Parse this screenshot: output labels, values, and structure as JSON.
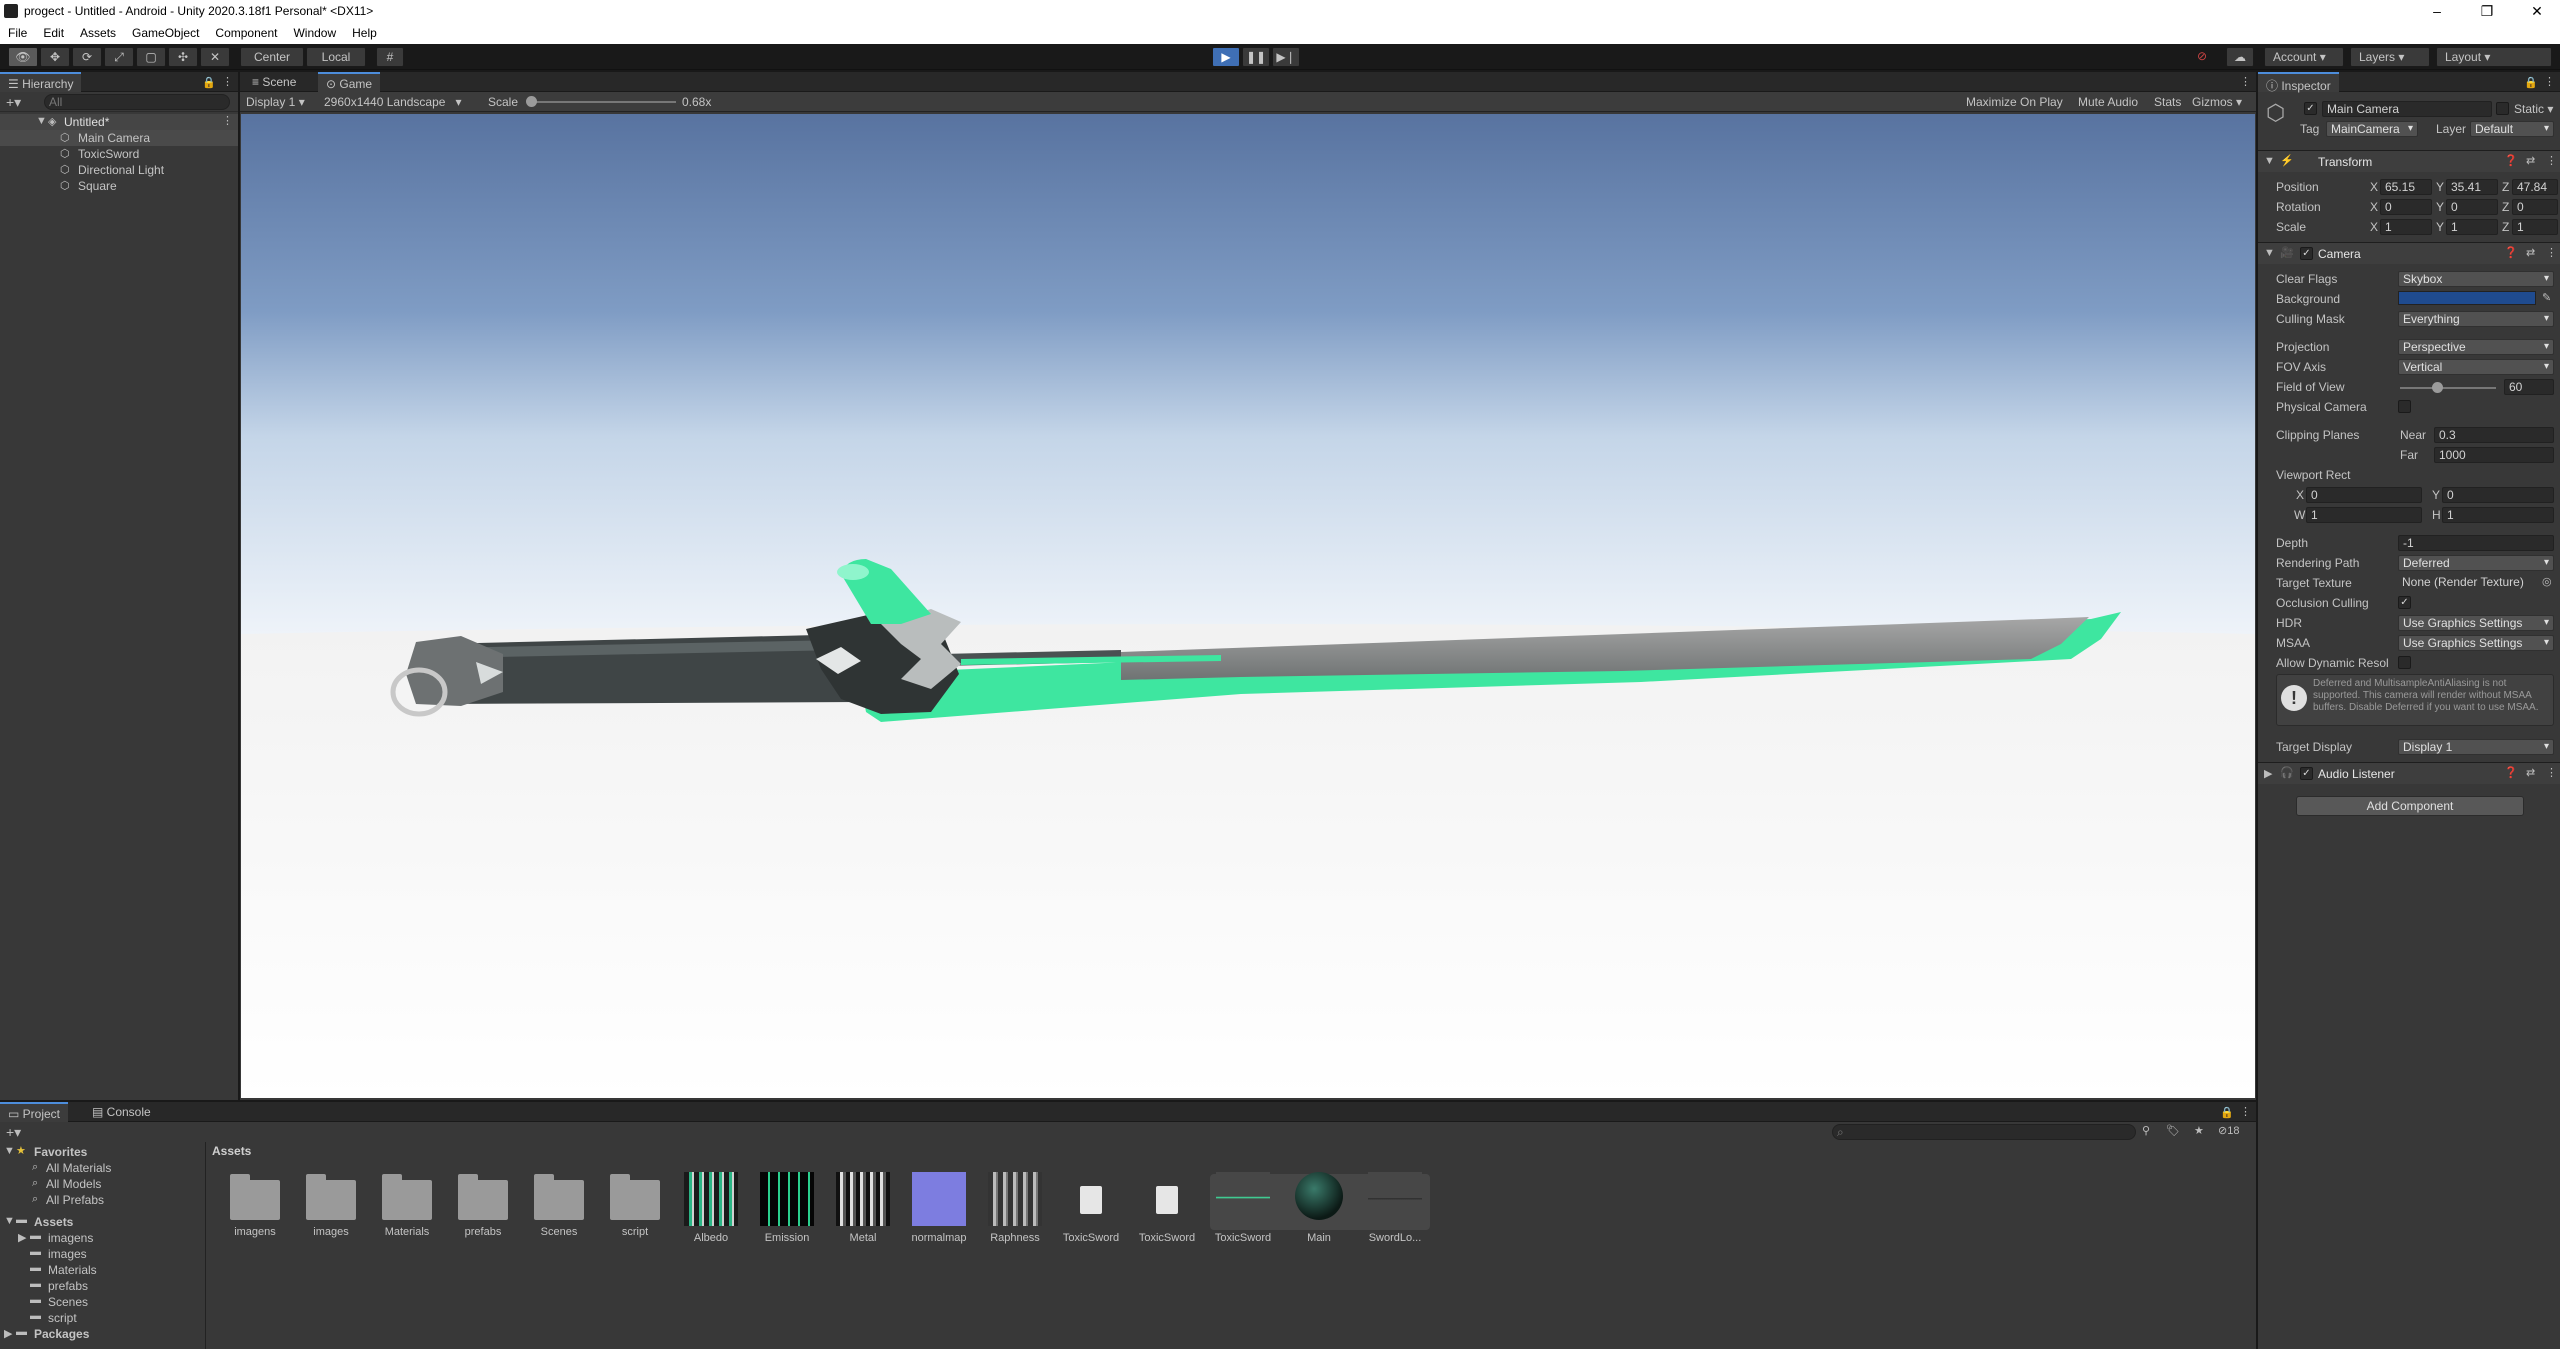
{
  "window": {
    "title": "progect - Untitled - Android - Unity 2020.3.18f1 Personal* <DX11>"
  },
  "menu": [
    "File",
    "Edit",
    "Assets",
    "GameObject",
    "Component",
    "Window",
    "Help"
  ],
  "toolbar": {
    "pivot": "Center",
    "space": "Local",
    "account": "Account",
    "layers": "Layers",
    "layout": "Layout"
  },
  "hierarchy": {
    "tab": "Hierarchy",
    "search_placeholder": "All",
    "scene": "Untitled*",
    "items": [
      "Main Camera",
      "ToxicSword",
      "Directional Light",
      "Square"
    ]
  },
  "game": {
    "tabs": [
      "Scene",
      "Game"
    ],
    "display": "Display 1",
    "resolution": "2960x1440 Landscape",
    "scale_label": "Scale",
    "scale_value": "0.68x",
    "options": [
      "Maximize On Play",
      "Mute Audio",
      "Stats",
      "Gizmos"
    ],
    "sky_top": "#5873a0",
    "sky_horizon": "#dde8f3",
    "ground": "#ffffff",
    "blade_glow": "#3ee6a0"
  },
  "inspector": {
    "tab": "Inspector",
    "object_name": "Main Camera",
    "static_label": "Static",
    "tag_label": "Tag",
    "tag_value": "MainCamera",
    "layer_label": "Layer",
    "layer_value": "Default",
    "transform": {
      "title": "Transform",
      "position": {
        "label": "Position",
        "x": "65.15",
        "y": "35.41",
        "z": "47.84"
      },
      "rotation": {
        "label": "Rotation",
        "x": "0",
        "y": "0",
        "z": "0"
      },
      "scale": {
        "label": "Scale",
        "x": "1",
        "y": "1",
        "z": "1"
      }
    },
    "camera": {
      "title": "Camera",
      "clear_flags": {
        "label": "Clear Flags",
        "value": "Skybox"
      },
      "background": {
        "label": "Background",
        "color": "#1f4b8f"
      },
      "culling_mask": {
        "label": "Culling Mask",
        "value": "Everything"
      },
      "projection": {
        "label": "Projection",
        "value": "Perspective"
      },
      "fov_axis": {
        "label": "FOV Axis",
        "value": "Vertical"
      },
      "field_of_view": {
        "label": "Field of View",
        "value": "60"
      },
      "physical_camera": {
        "label": "Physical Camera"
      },
      "clipping": {
        "label": "Clipping Planes",
        "near_label": "Near",
        "near": "0.3",
        "far_label": "Far",
        "far": "1000"
      },
      "viewport": {
        "label": "Viewport Rect",
        "x": "0",
        "y": "0",
        "w": "1",
        "h": "1"
      },
      "depth": {
        "label": "Depth",
        "value": "-1"
      },
      "rendering_path": {
        "label": "Rendering Path",
        "value": "Deferred"
      },
      "target_texture": {
        "label": "Target Texture",
        "value": "None (Render Texture)"
      },
      "occlusion": {
        "label": "Occlusion Culling"
      },
      "hdr": {
        "label": "HDR",
        "value": "Use Graphics Settings"
      },
      "msaa": {
        "label": "MSAA",
        "value": "Use Graphics Settings"
      },
      "dynamic_res": {
        "label": "Allow Dynamic Resol"
      },
      "warning": "Deferred and MultisampleAntiAliasing is not supported. This camera will render without MSAA buffers. Disable Deferred if you want to use MSAA.",
      "target_display": {
        "label": "Target Display",
        "value": "Display 1"
      }
    },
    "audio_listener": {
      "title": "Audio Listener"
    },
    "add_component": "Add Component"
  },
  "project": {
    "tabs": [
      "Project",
      "Console"
    ],
    "favorites_label": "Favorites",
    "favorites": [
      "All Materials",
      "All Models",
      "All Prefabs"
    ],
    "assets_label": "Assets",
    "folders": [
      "imagens",
      "images",
      "Materials",
      "prefabs",
      "Scenes",
      "script"
    ],
    "packages_label": "Packages",
    "breadcrumb": "Assets",
    "hidden_count": "18",
    "items": [
      {
        "name": "imagens",
        "kind": "folder"
      },
      {
        "name": "images",
        "kind": "folder"
      },
      {
        "name": "Materials",
        "kind": "folder"
      },
      {
        "name": "prefabs",
        "kind": "folder"
      },
      {
        "name": "Scenes",
        "kind": "folder"
      },
      {
        "name": "script",
        "kind": "folder"
      },
      {
        "name": "Albedo",
        "kind": "texture"
      },
      {
        "name": "Emission",
        "kind": "texture"
      },
      {
        "name": "Metal",
        "kind": "texture"
      },
      {
        "name": "normalmap",
        "kind": "texture"
      },
      {
        "name": "Raphness",
        "kind": "texture"
      },
      {
        "name": "ToxicSword",
        "kind": "file"
      },
      {
        "name": "ToxicSword",
        "kind": "file"
      },
      {
        "name": "ToxicSword",
        "kind": "model"
      },
      {
        "name": "Main",
        "kind": "material"
      },
      {
        "name": "SwordLo...",
        "kind": "model"
      }
    ]
  }
}
